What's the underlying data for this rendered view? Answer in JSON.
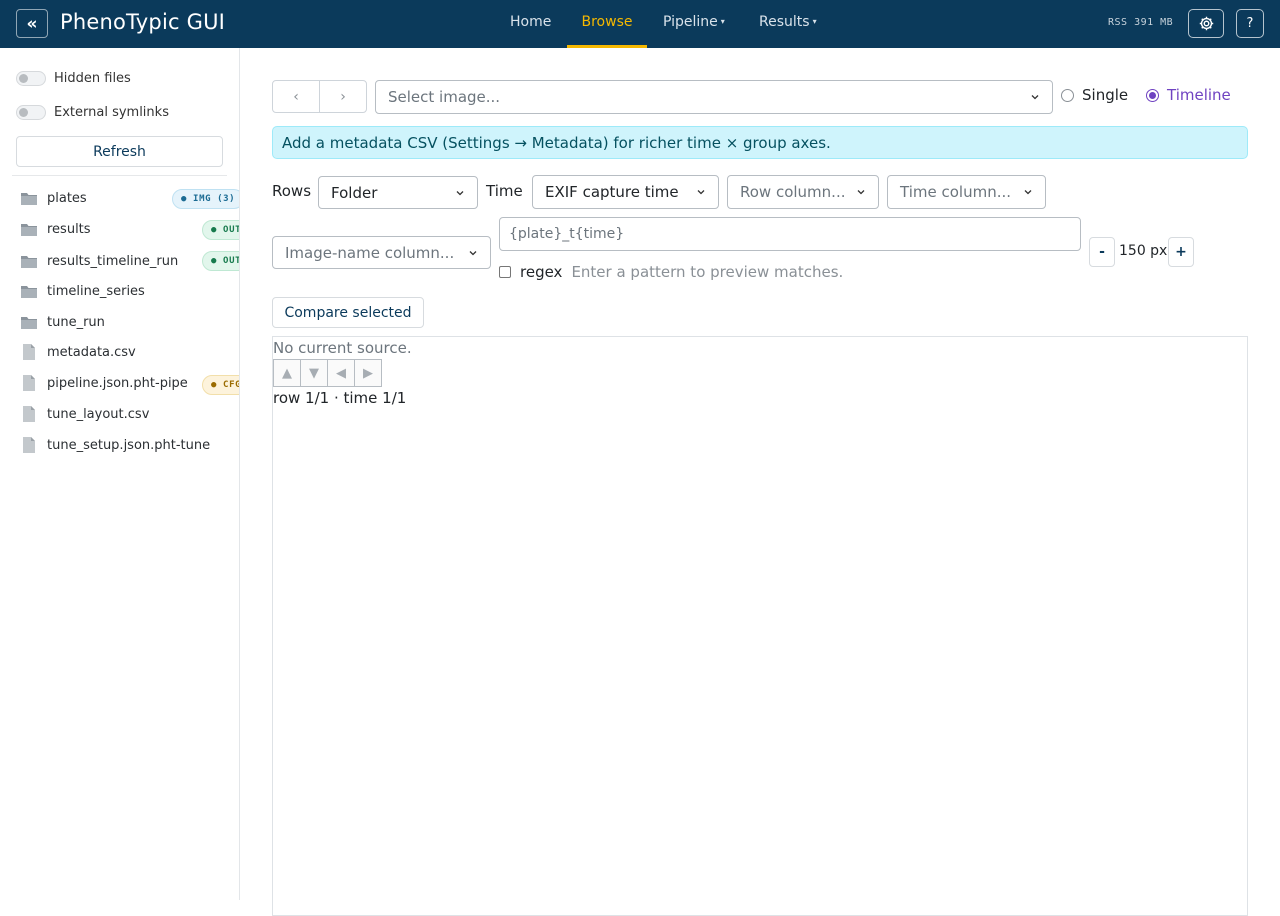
{
  "app": {
    "title": "PhenoTypic GUI",
    "collapse_label": "«"
  },
  "nav": {
    "items": [
      {
        "label": "Home",
        "dropdown": false,
        "active": false
      },
      {
        "label": "Browse",
        "dropdown": false,
        "active": true
      },
      {
        "label": "Pipeline",
        "dropdown": true,
        "active": false
      },
      {
        "label": "Results",
        "dropdown": true,
        "active": false
      }
    ],
    "rss": "RSS 391 MB",
    "help_label": "?"
  },
  "colors": {
    "navbar": "#0b3a5b",
    "accent": "#f5b800",
    "radio_accent": "#6f42c1",
    "alert_bg": "#cff4fc"
  },
  "sidebar": {
    "toggles": [
      {
        "label": "Hidden files",
        "on": false
      },
      {
        "label": "External symlinks",
        "on": false
      }
    ],
    "refresh_label": "Refresh",
    "files": [
      {
        "name": "plates",
        "icon": "folder-icon",
        "badge": "IMG (3)",
        "badge_kind": "img"
      },
      {
        "name": "results",
        "icon": "folder-icon",
        "badge": "OUT",
        "badge_kind": "out"
      },
      {
        "name": "results_timeline_run",
        "icon": "folder-icon",
        "badge": "OUT",
        "badge_kind": "out"
      },
      {
        "name": "timeline_series",
        "icon": "folder-icon"
      },
      {
        "name": "tune_run",
        "icon": "folder-icon"
      },
      {
        "name": "metadata.csv",
        "icon": "file-icon"
      },
      {
        "name": "pipeline.json.pht-pipe",
        "icon": "file-icon",
        "badge": "CFG",
        "badge_kind": "cfg"
      },
      {
        "name": "tune_layout.csv",
        "icon": "file-icon"
      },
      {
        "name": "tune_setup.json.pht-tune",
        "icon": "file-icon"
      }
    ]
  },
  "main": {
    "prev_label": "‹",
    "next_label": "›",
    "image_select_placeholder": "Select image...",
    "view_modes": [
      {
        "label": "Single",
        "selected": false
      },
      {
        "label": "Timeline",
        "selected": true
      }
    ],
    "alert": "Add a metadata CSV (Settings → Metadata) for richer time × group axes.",
    "rows_label": "Rows",
    "rows_value": "Folder",
    "time_label": "Time",
    "time_value": "EXIF capture time",
    "row_column_placeholder": "Row column...",
    "time_column_placeholder": "Time column...",
    "image_name_column_placeholder": "Image-name column...",
    "pattern_value": "{plate}_t{time}",
    "regex_label": "regex",
    "regex_checked": false,
    "pattern_hint": "Enter a pattern to preview matches.",
    "zoom_minus": "-",
    "zoom_value": "150 px",
    "zoom_plus": "+",
    "compare_label": "Compare selected",
    "viewer": {
      "no_source": "No current source.",
      "arrows": [
        "▲",
        "▼",
        "◀",
        "▶"
      ],
      "position": "row 1/1 · time 1/1"
    }
  }
}
